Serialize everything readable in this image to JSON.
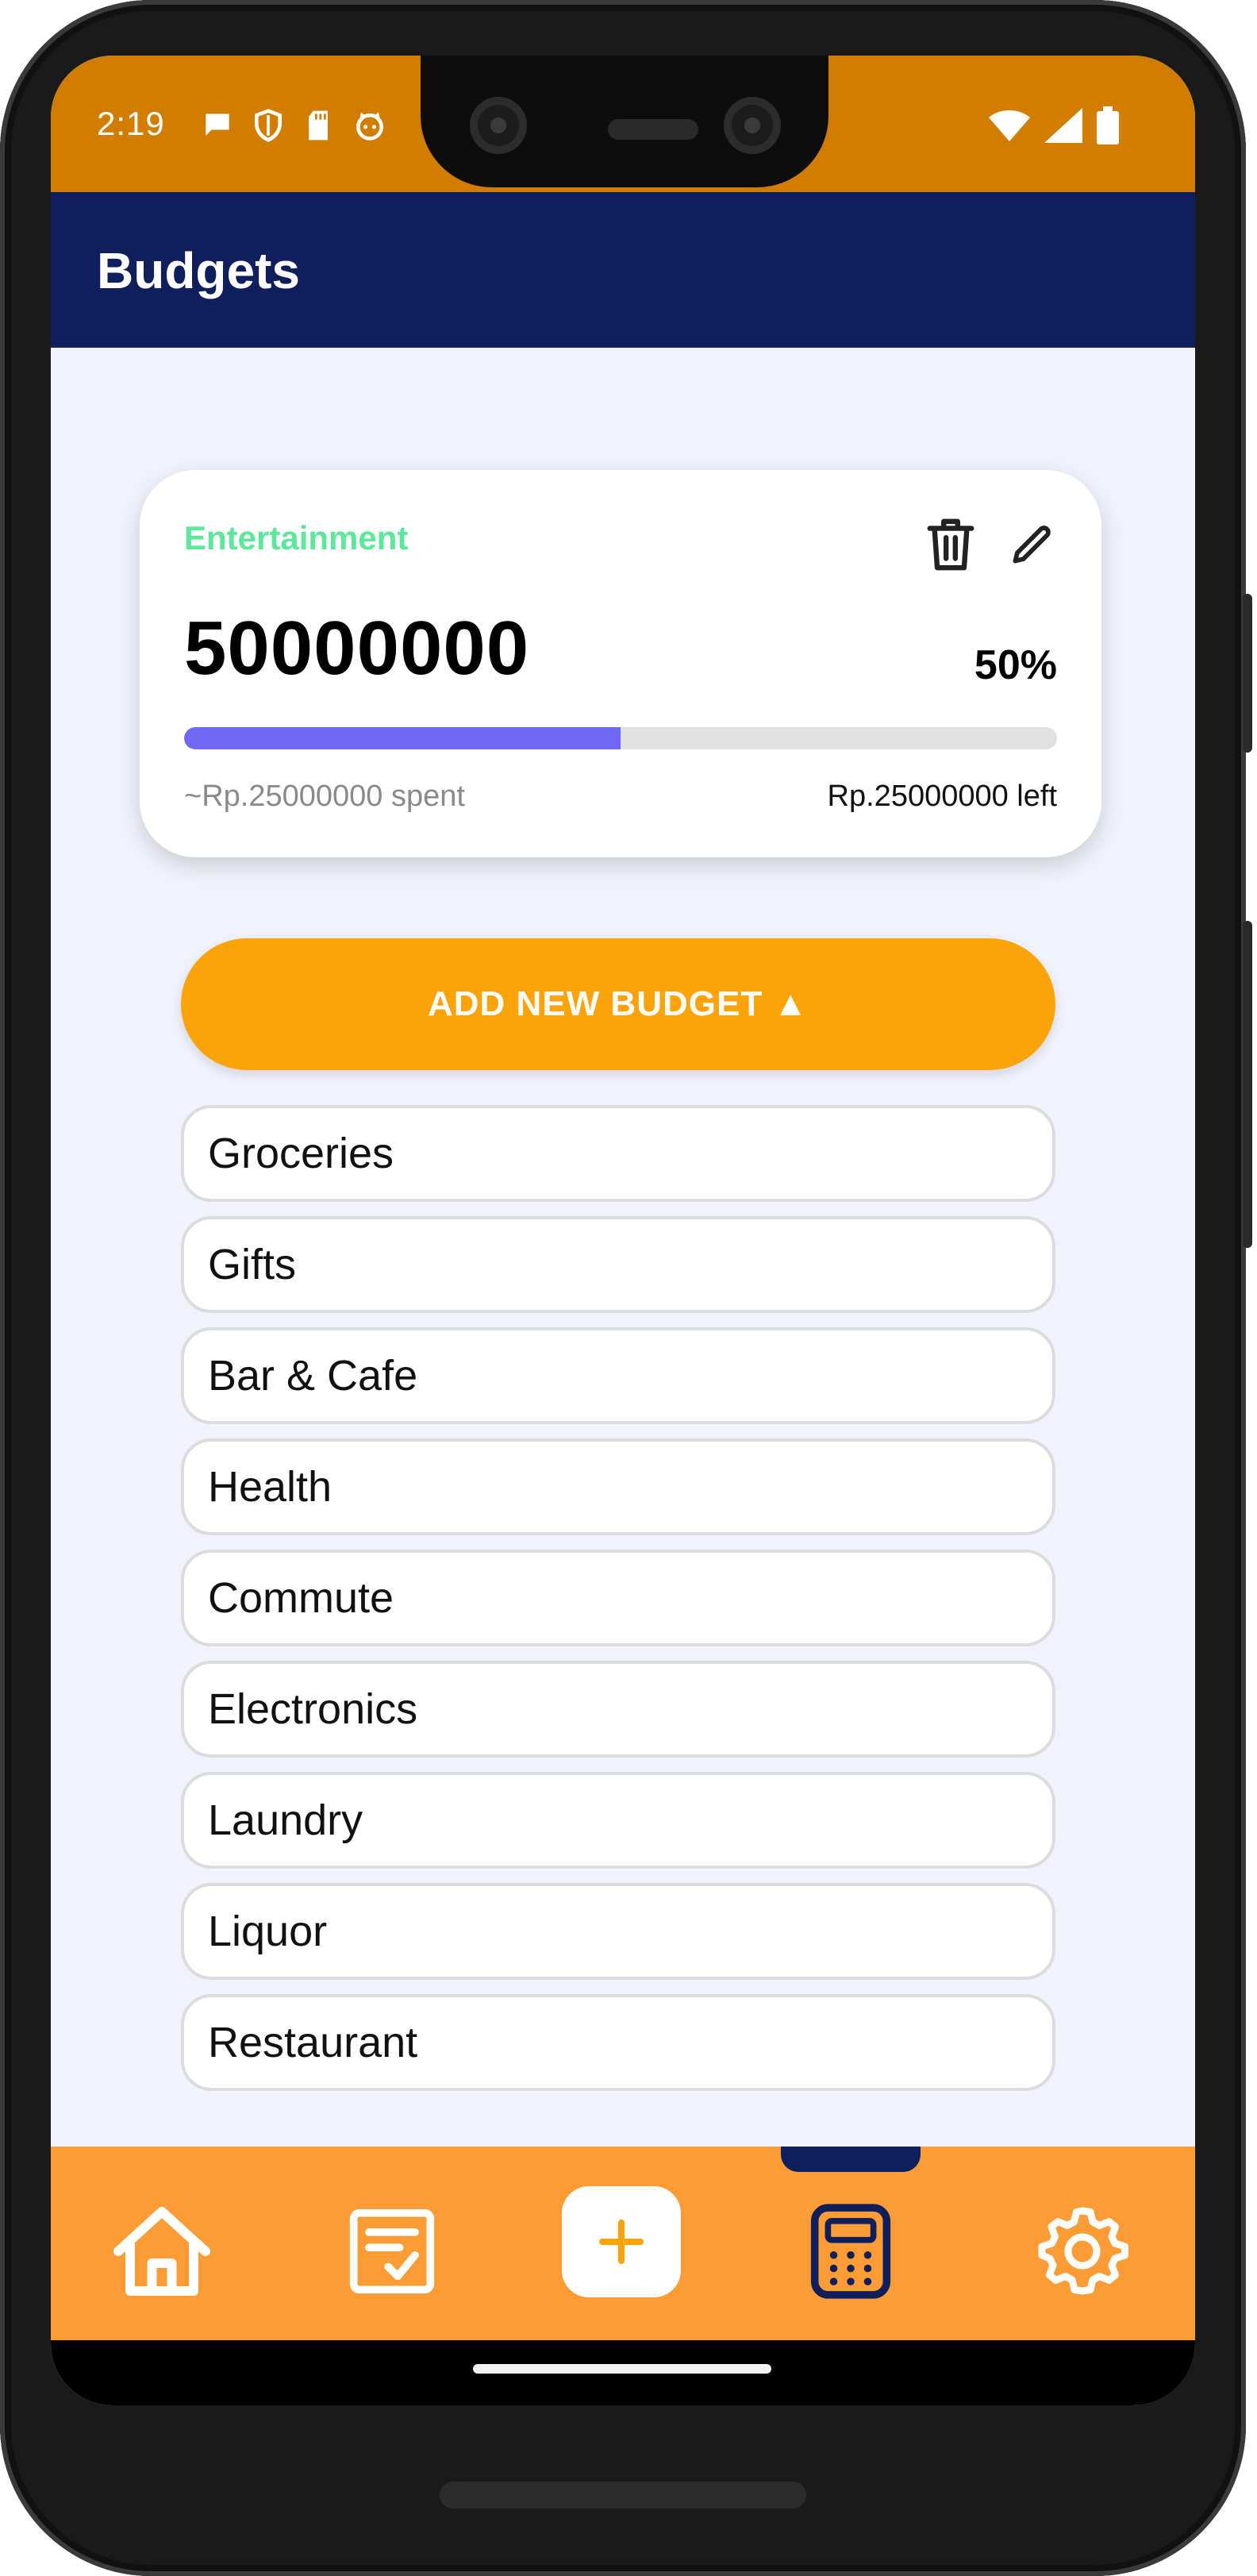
{
  "status_bar": {
    "time": "2:19",
    "left_icons": [
      "chat-bubble-icon",
      "shield-icon",
      "sd-card-icon",
      "cat-face-icon"
    ],
    "right_icons": [
      "wifi-icon",
      "cell-signal-icon",
      "battery-icon"
    ]
  },
  "app_bar": {
    "title": "Budgets"
  },
  "budget_card": {
    "category": "Entertainment",
    "amount": "50000000",
    "percent": "50%",
    "progress_fraction": 0.5,
    "spent_text": "~Rp.25000000 spent",
    "left_text": "Rp.25000000 left",
    "actions": [
      "trash-icon",
      "pencil-icon"
    ]
  },
  "add_button": {
    "label": "ADD NEW BUDGET ▲"
  },
  "categories": [
    "Groceries",
    "Gifts",
    "Bar & Cafe",
    "Health",
    "Commute",
    "Electronics",
    "Laundry",
    "Liquor",
    "Restaurant"
  ],
  "bottom_nav": {
    "items": [
      "home-icon",
      "checklist-icon",
      "plus-icon",
      "calculator-icon",
      "gear-icon"
    ],
    "active": "calculator-icon"
  },
  "colors": {
    "status_bar": "#d07d00",
    "app_bar": "#0f1f5c",
    "accent_orange": "#fca30a",
    "nav_bar": "#fd9c34",
    "category_text": "#5be89b",
    "progress": "#6f67f5"
  }
}
